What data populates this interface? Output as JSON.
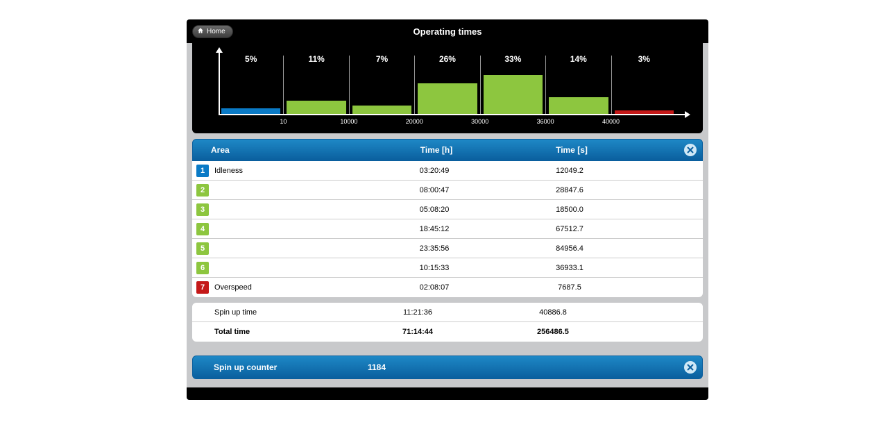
{
  "header": {
    "home_label": "Home",
    "title": "Operating times"
  },
  "chart_data": {
    "type": "bar",
    "title": "",
    "xlabel": "",
    "ylabel": "",
    "categories": [
      "10",
      "10000",
      "20000",
      "30000",
      "36000",
      "40000",
      ""
    ],
    "values_pct": [
      5,
      11,
      7,
      26,
      33,
      14,
      3
    ],
    "series": [
      {
        "name": "Area 1",
        "value": 5,
        "color": "#0a7ac6"
      },
      {
        "name": "Area 2",
        "value": 11,
        "color": "#8dc63f"
      },
      {
        "name": "Area 3",
        "value": 7,
        "color": "#8dc63f"
      },
      {
        "name": "Area 4",
        "value": 26,
        "color": "#8dc63f"
      },
      {
        "name": "Area 5",
        "value": 33,
        "color": "#8dc63f"
      },
      {
        "name": "Area 6",
        "value": 14,
        "color": "#8dc63f"
      },
      {
        "name": "Area 7",
        "value": 3,
        "color": "#c41818"
      }
    ],
    "ylim": [
      0,
      40
    ]
  },
  "table": {
    "headers": {
      "area": "Area",
      "time_h": "Time [h]",
      "time_s": "Time [s]"
    },
    "rows": [
      {
        "idx": "1",
        "color": "blue",
        "label": "Idleness",
        "time_h": "03:20:49",
        "time_s": "12049.2"
      },
      {
        "idx": "2",
        "color": "green",
        "label": "",
        "time_h": "08:00:47",
        "time_s": "28847.6"
      },
      {
        "idx": "3",
        "color": "green",
        "label": "",
        "time_h": "05:08:20",
        "time_s": "18500.0"
      },
      {
        "idx": "4",
        "color": "green",
        "label": "",
        "time_h": "18:45:12",
        "time_s": "67512.7"
      },
      {
        "idx": "5",
        "color": "green",
        "label": "",
        "time_h": "23:35:56",
        "time_s": "84956.4"
      },
      {
        "idx": "6",
        "color": "green",
        "label": "",
        "time_h": "10:15:33",
        "time_s": "36933.1"
      },
      {
        "idx": "7",
        "color": "red",
        "label": "Overspeed",
        "time_h": "02:08:07",
        "time_s": "7687.5"
      }
    ]
  },
  "summary": {
    "spin_up": {
      "label": "Spin up time",
      "time_h": "11:21:36",
      "time_s": "40886.8"
    },
    "total": {
      "label": "Total time",
      "time_h": "71:14:44",
      "time_s": "256486.5"
    }
  },
  "counter": {
    "label": "Spin up counter",
    "value": "1184"
  },
  "colors": {
    "blue": "#0a7ac6",
    "green": "#8dc63f",
    "red": "#c41818"
  }
}
